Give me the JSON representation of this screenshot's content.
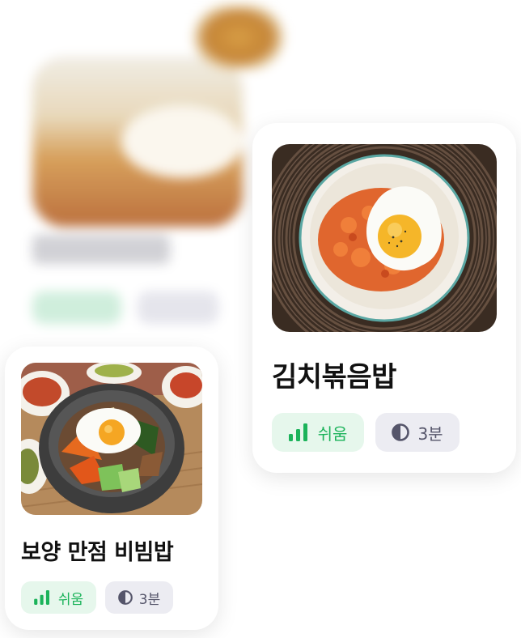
{
  "cards": [
    {
      "title": "김치볶음밥",
      "difficulty": "쉬움",
      "time": "3분",
      "difficulty_icon": "signal-bars-icon",
      "time_icon": "clock-pie-icon"
    },
    {
      "title": "보양 만점 비빔밥",
      "difficulty": "쉬움",
      "time": "3분",
      "difficulty_icon": "signal-bars-icon",
      "time_icon": "clock-pie-icon"
    }
  ],
  "colors": {
    "difficulty_bg": "#e6f7ec",
    "difficulty_text": "#1bb35a",
    "time_bg": "#ececf2",
    "time_text": "#55556a"
  }
}
